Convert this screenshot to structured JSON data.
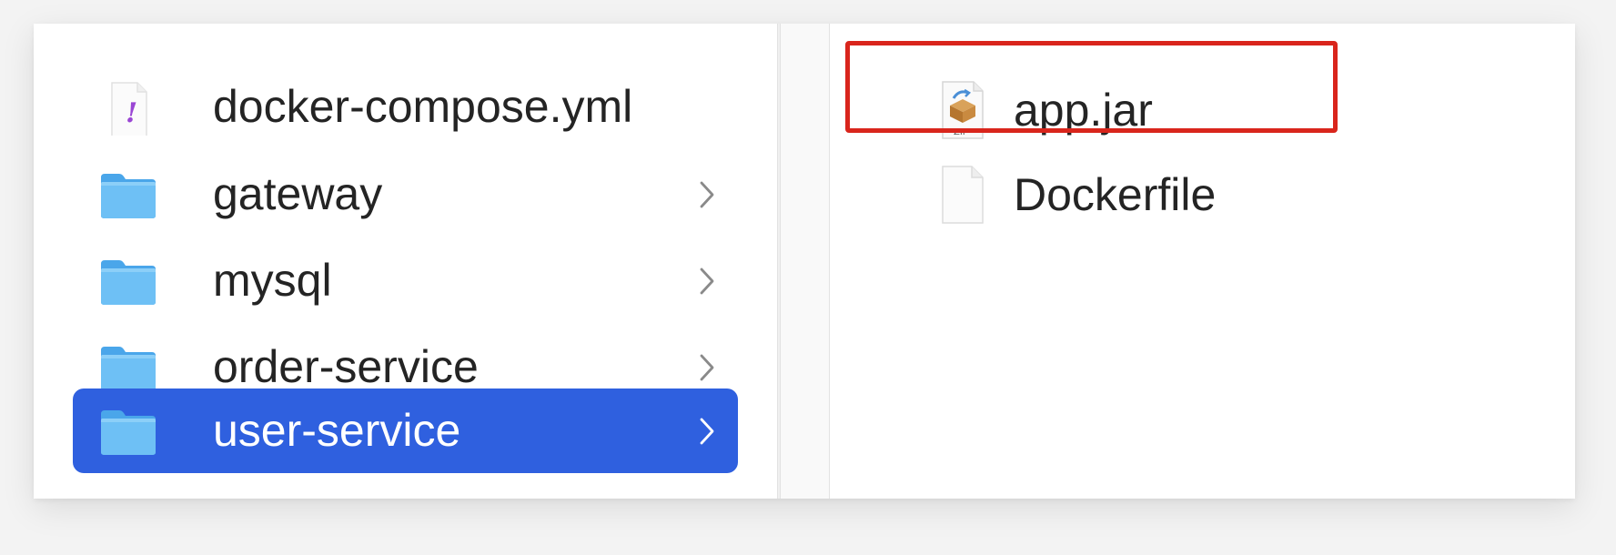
{
  "left_column": {
    "items": [
      {
        "label": "docker-compose.yml",
        "icon": "yaml-file-icon",
        "type": "file",
        "selected": false
      },
      {
        "label": "gateway",
        "icon": "folder-icon",
        "type": "folder",
        "selected": false
      },
      {
        "label": "mysql",
        "icon": "folder-icon",
        "type": "folder",
        "selected": false
      },
      {
        "label": "order-service",
        "icon": "folder-icon",
        "type": "folder",
        "selected": false
      },
      {
        "label": "user-service",
        "icon": "folder-icon",
        "type": "folder",
        "selected": true
      }
    ]
  },
  "right_column": {
    "items": [
      {
        "label": "app.jar",
        "icon": "zip-archive-icon",
        "highlighted": true
      },
      {
        "label": "Dockerfile",
        "icon": "document-icon",
        "highlighted": false
      }
    ]
  },
  "colors": {
    "selection": "#2f60df",
    "folder": "#56b2f0",
    "highlight": "#d9251c",
    "text": "#242424"
  }
}
